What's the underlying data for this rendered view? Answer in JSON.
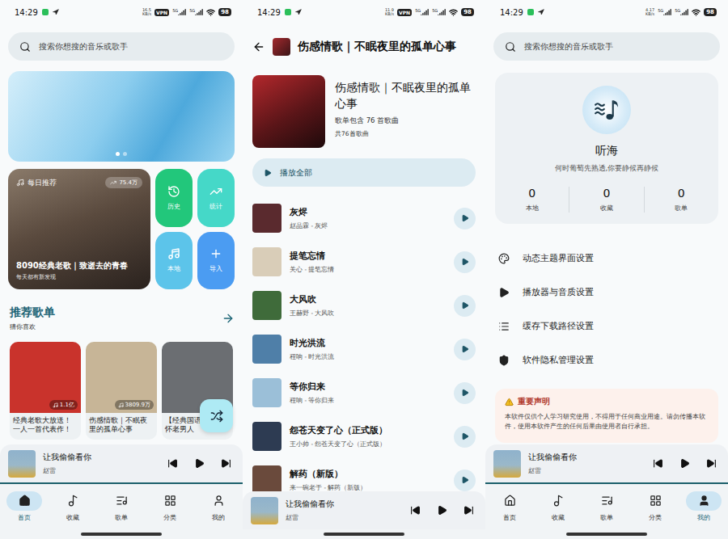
{
  "home": {
    "status_bar": {
      "time": "14:29",
      "speed": "16.5",
      "speed_unit": "KB/s",
      "badges": [
        "VPN"
      ],
      "networks": [
        "5G",
        "5G"
      ],
      "battery": "98"
    },
    "search": {
      "placeholder": "搜索你想搜的音乐或歌手"
    },
    "banner": {
      "dots": [
        {
          "selected": true
        },
        {
          "selected": false
        }
      ]
    },
    "daily": {
      "tag": "每日推荐",
      "plays": "75.4万",
      "title": "8090经典老歌｜致逝去的青春",
      "subtitle": "每天都有新发现"
    },
    "quick_actions": [
      {
        "label": "历史",
        "kind": "history",
        "color": "#22c77b"
      },
      {
        "label": "统计",
        "kind": "stats",
        "color": "#45d8c8"
      },
      {
        "label": "本地",
        "kind": "local",
        "color": "#5cc4ea"
      },
      {
        "label": "导入",
        "kind": "import",
        "color": "#4b9cf2"
      }
    ],
    "section": {
      "title": "推荐歌单",
      "subtitle": "猜你喜欢"
    },
    "playlists": [
      {
        "title": "经典老歌大放送！一人一首代表作！",
        "plays": "1.1亿",
        "color": "#c9332c"
      },
      {
        "title": "伤感情歌｜不眠夜里的孤单心事",
        "plays": "3809.9万",
        "color": "#c7b597"
      },
      {
        "title": "【经典国语人的情怀老男人",
        "color": "#6b6e72"
      }
    ],
    "mini_player": {
      "title": "让我偷偷看你",
      "artist": "赵雷",
      "playing": false
    },
    "nav": [
      {
        "label": "首页",
        "kind": "home",
        "selected": true
      },
      {
        "label": "收藏",
        "kind": "favorites",
        "selected": false
      },
      {
        "label": "歌单",
        "kind": "playlists",
        "selected": false
      },
      {
        "label": "分类",
        "kind": "categories",
        "selected": false
      },
      {
        "label": "我的",
        "kind": "mine",
        "selected": false
      }
    ]
  },
  "playlist": {
    "status_bar": {
      "time": "14:29",
      "speed": "11.9",
      "speed_unit": "KB/s",
      "badges": [
        "VPN"
      ],
      "networks": [
        "5G",
        "5G"
      ],
      "battery": "98"
    },
    "header": {
      "title": "伤感情歌｜不眠夜里的孤单心事"
    },
    "info": {
      "title": "伤感情歌｜不眠夜里的孤单心事",
      "description": "歌单包含 76 首歌曲",
      "count": "共76首歌曲"
    },
    "play_all": "播放全部",
    "songs": [
      {
        "name": "灰烬",
        "subtitle": "赵晶霖 - 灰烬",
        "color": "#5a2a2e"
      },
      {
        "name": "提笔忘情",
        "subtitle": "关心 - 提笔忘情",
        "color": "#d9cdb8"
      },
      {
        "name": "大风吹",
        "subtitle": "王赫野 - 大风吹",
        "color": "#3f6b3a"
      },
      {
        "name": "时光洪流",
        "subtitle": "程响 - 时光洪流",
        "color": "#4f7fa8"
      },
      {
        "name": "等你归来",
        "subtitle": "程响 - 等你归来",
        "color": "#9bbfd8"
      },
      {
        "name": "怨苍天变了心（正式版）",
        "subtitle": "王小帅 - 怨苍天变了心（正式版）",
        "color": "#2d3b52"
      },
      {
        "name": "解药（新版）",
        "subtitle": "来一碗老于 - 解药（新版）",
        "color": "#6a4a3c"
      }
    ],
    "mini_player": {
      "title": "让我偷偷看你",
      "artist": "赵雷",
      "playing": false
    }
  },
  "profile": {
    "status_bar": {
      "time": "14:29",
      "speed": "4.17",
      "speed_unit": "KB/s",
      "badges": [],
      "networks": [
        "5G",
        "5G"
      ],
      "battery": "98"
    },
    "search": {
      "placeholder": "搜索你想搜的音乐或歌手"
    },
    "user": {
      "name": "听海",
      "motto": "何时葡萄先熟透,你要静候再静候"
    },
    "stats": [
      {
        "value": "0",
        "label": "本地"
      },
      {
        "value": "0",
        "label": "收藏"
      },
      {
        "value": "0",
        "label": "歌单"
      }
    ],
    "settings": [
      {
        "label": "动态主题界面设置",
        "kind": "theme"
      },
      {
        "label": "播放器与音质设置",
        "kind": "player"
      },
      {
        "label": "缓存下载路径设置",
        "kind": "cache"
      },
      {
        "label": "软件隐私管理设置",
        "kind": "privacy"
      }
    ],
    "notice": {
      "title": "重要声明",
      "body": "本软件仅供个人学习研究使用，不得用于任何商业用途。请勿传播本软件，使用本软件产生的任何后果由使用者自行承担。"
    },
    "mini_player": {
      "title": "让我偷偷看你",
      "artist": "赵雷",
      "playing": false
    },
    "nav": [
      {
        "label": "首页",
        "kind": "home",
        "selected": false
      },
      {
        "label": "收藏",
        "kind": "favorites",
        "selected": false
      },
      {
        "label": "歌单",
        "kind": "playlists",
        "selected": false
      },
      {
        "label": "分类",
        "kind": "categories",
        "selected": false
      },
      {
        "label": "我的",
        "kind": "mine",
        "selected": true
      }
    ]
  }
}
